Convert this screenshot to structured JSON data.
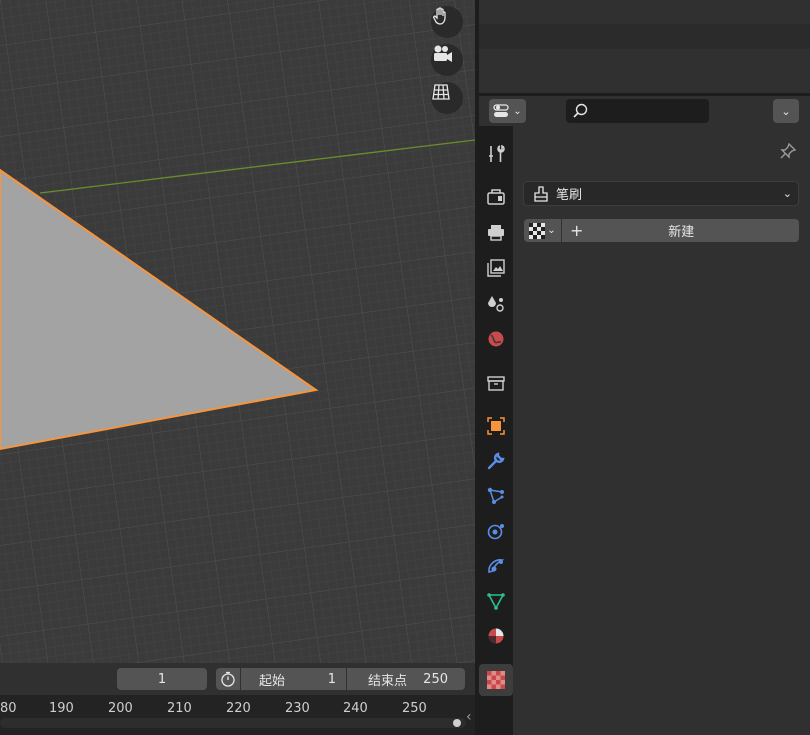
{
  "timeline": {
    "current_frame": "1",
    "start_label": "起始",
    "start_value": "1",
    "end_label": "结束点",
    "end_value": "250",
    "ticks": [
      "80",
      "190",
      "200",
      "210",
      "220",
      "230",
      "240",
      "250"
    ],
    "collapse_glyph": "‹"
  },
  "properties": {
    "search_placeholder": "",
    "brush_label": "笔刷",
    "new_button_label": "新建",
    "new_plus_glyph": "+",
    "dropdown_glyph": "⌄"
  },
  "colors": {
    "accent_orange": "#f7943c",
    "axis_green": "#6a8d2c",
    "plane_gray": "#a3a3a3"
  },
  "icons": [
    "hand-icon",
    "camera-icon",
    "grid-icon",
    "tool-icon",
    "render-icon",
    "output-icon",
    "view-layer-icon",
    "scene-icon",
    "world-icon",
    "collection-icon",
    "object-icon",
    "modifier-icon",
    "particles-icon",
    "physics-icon",
    "constraints-icon",
    "data-icon",
    "material-icon",
    "texture-icon"
  ]
}
